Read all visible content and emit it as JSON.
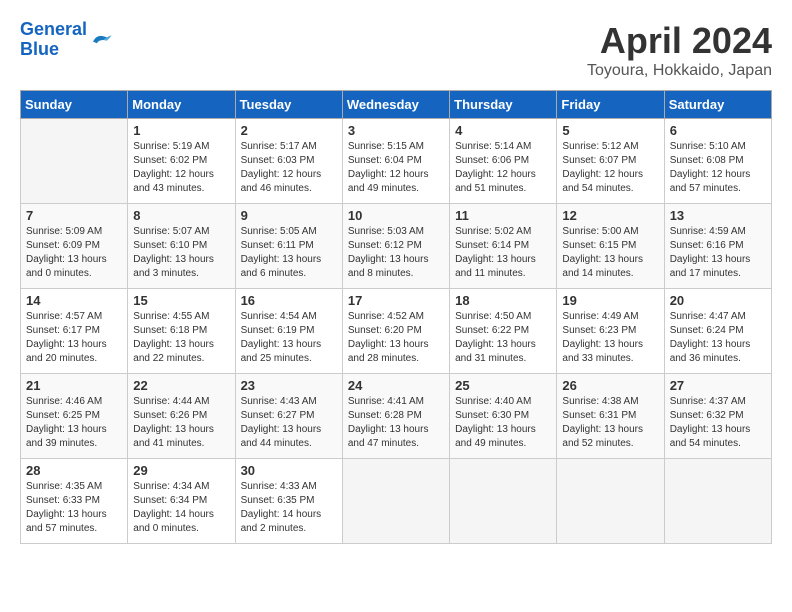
{
  "header": {
    "logo_line1": "General",
    "logo_line2": "Blue",
    "month_year": "April 2024",
    "location": "Toyoura, Hokkaido, Japan"
  },
  "columns": [
    "Sunday",
    "Monday",
    "Tuesday",
    "Wednesday",
    "Thursday",
    "Friday",
    "Saturday"
  ],
  "weeks": [
    [
      {
        "day": "",
        "info": ""
      },
      {
        "day": "1",
        "info": "Sunrise: 5:19 AM\nSunset: 6:02 PM\nDaylight: 12 hours\nand 43 minutes."
      },
      {
        "day": "2",
        "info": "Sunrise: 5:17 AM\nSunset: 6:03 PM\nDaylight: 12 hours\nand 46 minutes."
      },
      {
        "day": "3",
        "info": "Sunrise: 5:15 AM\nSunset: 6:04 PM\nDaylight: 12 hours\nand 49 minutes."
      },
      {
        "day": "4",
        "info": "Sunrise: 5:14 AM\nSunset: 6:06 PM\nDaylight: 12 hours\nand 51 minutes."
      },
      {
        "day": "5",
        "info": "Sunrise: 5:12 AM\nSunset: 6:07 PM\nDaylight: 12 hours\nand 54 minutes."
      },
      {
        "day": "6",
        "info": "Sunrise: 5:10 AM\nSunset: 6:08 PM\nDaylight: 12 hours\nand 57 minutes."
      }
    ],
    [
      {
        "day": "7",
        "info": "Sunrise: 5:09 AM\nSunset: 6:09 PM\nDaylight: 13 hours\nand 0 minutes."
      },
      {
        "day": "8",
        "info": "Sunrise: 5:07 AM\nSunset: 6:10 PM\nDaylight: 13 hours\nand 3 minutes."
      },
      {
        "day": "9",
        "info": "Sunrise: 5:05 AM\nSunset: 6:11 PM\nDaylight: 13 hours\nand 6 minutes."
      },
      {
        "day": "10",
        "info": "Sunrise: 5:03 AM\nSunset: 6:12 PM\nDaylight: 13 hours\nand 8 minutes."
      },
      {
        "day": "11",
        "info": "Sunrise: 5:02 AM\nSunset: 6:14 PM\nDaylight: 13 hours\nand 11 minutes."
      },
      {
        "day": "12",
        "info": "Sunrise: 5:00 AM\nSunset: 6:15 PM\nDaylight: 13 hours\nand 14 minutes."
      },
      {
        "day": "13",
        "info": "Sunrise: 4:59 AM\nSunset: 6:16 PM\nDaylight: 13 hours\nand 17 minutes."
      }
    ],
    [
      {
        "day": "14",
        "info": "Sunrise: 4:57 AM\nSunset: 6:17 PM\nDaylight: 13 hours\nand 20 minutes."
      },
      {
        "day": "15",
        "info": "Sunrise: 4:55 AM\nSunset: 6:18 PM\nDaylight: 13 hours\nand 22 minutes."
      },
      {
        "day": "16",
        "info": "Sunrise: 4:54 AM\nSunset: 6:19 PM\nDaylight: 13 hours\nand 25 minutes."
      },
      {
        "day": "17",
        "info": "Sunrise: 4:52 AM\nSunset: 6:20 PM\nDaylight: 13 hours\nand 28 minutes."
      },
      {
        "day": "18",
        "info": "Sunrise: 4:50 AM\nSunset: 6:22 PM\nDaylight: 13 hours\nand 31 minutes."
      },
      {
        "day": "19",
        "info": "Sunrise: 4:49 AM\nSunset: 6:23 PM\nDaylight: 13 hours\nand 33 minutes."
      },
      {
        "day": "20",
        "info": "Sunrise: 4:47 AM\nSunset: 6:24 PM\nDaylight: 13 hours\nand 36 minutes."
      }
    ],
    [
      {
        "day": "21",
        "info": "Sunrise: 4:46 AM\nSunset: 6:25 PM\nDaylight: 13 hours\nand 39 minutes."
      },
      {
        "day": "22",
        "info": "Sunrise: 4:44 AM\nSunset: 6:26 PM\nDaylight: 13 hours\nand 41 minutes."
      },
      {
        "day": "23",
        "info": "Sunrise: 4:43 AM\nSunset: 6:27 PM\nDaylight: 13 hours\nand 44 minutes."
      },
      {
        "day": "24",
        "info": "Sunrise: 4:41 AM\nSunset: 6:28 PM\nDaylight: 13 hours\nand 47 minutes."
      },
      {
        "day": "25",
        "info": "Sunrise: 4:40 AM\nSunset: 6:30 PM\nDaylight: 13 hours\nand 49 minutes."
      },
      {
        "day": "26",
        "info": "Sunrise: 4:38 AM\nSunset: 6:31 PM\nDaylight: 13 hours\nand 52 minutes."
      },
      {
        "day": "27",
        "info": "Sunrise: 4:37 AM\nSunset: 6:32 PM\nDaylight: 13 hours\nand 54 minutes."
      }
    ],
    [
      {
        "day": "28",
        "info": "Sunrise: 4:35 AM\nSunset: 6:33 PM\nDaylight: 13 hours\nand 57 minutes."
      },
      {
        "day": "29",
        "info": "Sunrise: 4:34 AM\nSunset: 6:34 PM\nDaylight: 14 hours\nand 0 minutes."
      },
      {
        "day": "30",
        "info": "Sunrise: 4:33 AM\nSunset: 6:35 PM\nDaylight: 14 hours\nand 2 minutes."
      },
      {
        "day": "",
        "info": ""
      },
      {
        "day": "",
        "info": ""
      },
      {
        "day": "",
        "info": ""
      },
      {
        "day": "",
        "info": ""
      }
    ]
  ]
}
